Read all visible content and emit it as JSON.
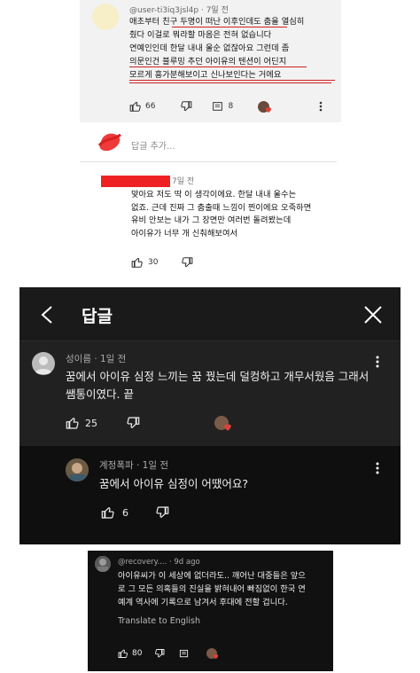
{
  "panel1": {
    "meta": "@user-ti3iq3jsl4p · 7일 전",
    "lines": [
      "애초부터 친구 두명이 떠난 이후인데도 춤을 열심히",
      "췄다 이걸로 뭐라할 마음은 전혀 없습니다",
      "연예인인데 한달 내내 울순 없잖아요 그런데 좀",
      "의문인건 블루밍 추던 아이유의 텐션이 어딘지",
      "모르게 흥가분해보이고 신나보인다는 거에요"
    ],
    "like_count": "66",
    "reply_count": "8"
  },
  "reply_input": {
    "placeholder": "답글 추가..."
  },
  "panel2": {
    "meta": "7일 전",
    "lines": [
      "맞아요 저도 딱 이 생각이에요. 한달 내내 울수는",
      "없죠. 근데 진짜 그 춤출때 느낌이 찐이에요 오죽하면",
      "유비 안보는 내가 그 장면만 여러번 돌려봤는데",
      "아이유가 너무 개 신춰해보여서"
    ],
    "like_count": "30"
  },
  "panel3": {
    "header_title": "답글",
    "comment1": {
      "meta": "성이름 · 1일 전",
      "lines": [
        "꿈에서 아이유 심정 느끼는 꿈 꿨는데 덜컹하고 개무서웠음 그래서",
        "쌤통이였다. 끝"
      ],
      "like_count": "25"
    },
    "comment2": {
      "meta": "계정폭파 · 1일 전",
      "text": "꿈에서 아이유 심정이 어땠어요?",
      "like_count": "6"
    }
  },
  "panel4": {
    "meta": "@recovery.... · 9d ago",
    "lines": [
      "아이유씨가 이 세상에 없더라도.. 깨어난 대중들은 앞으",
      "로 그 모든 의혹들의 진실을 밝혀내어 빠짐없이 한국 연",
      "예계 역사에 기록으로 남겨서 후대에 전할 겁니다."
    ],
    "translate_label": "Translate to English",
    "like_count": "80"
  },
  "colors": {
    "underline_red": "#d02020",
    "redaction_red": "#ee2222",
    "dark_bg": "#181818",
    "heart_red": "#e0403a"
  }
}
